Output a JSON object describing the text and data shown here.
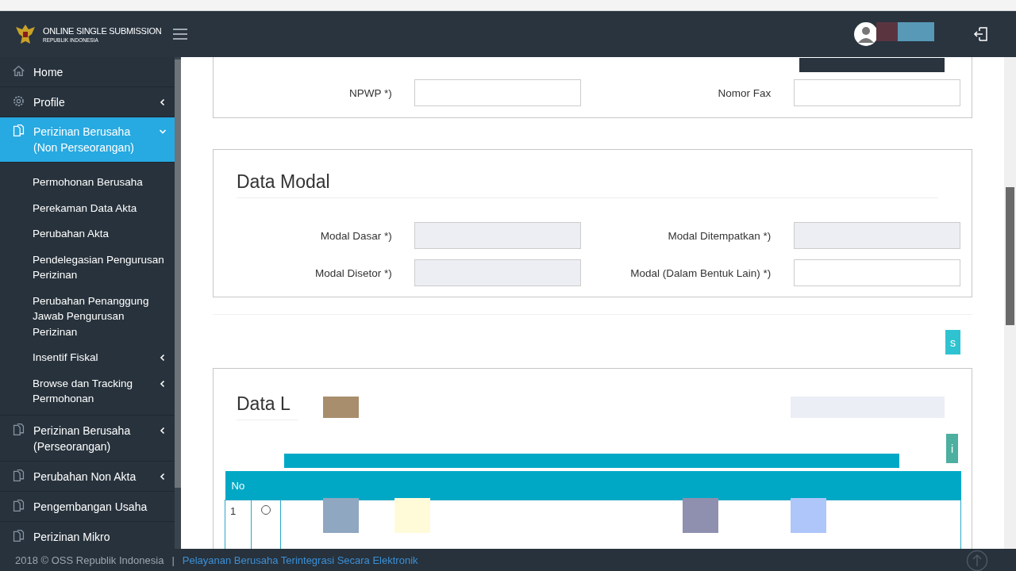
{
  "header": {
    "brand_title": "ONLINE SINGLE SUBMISSION",
    "brand_subtitle": "REPUBLIK INDONESIA"
  },
  "sidebar": {
    "items": [
      {
        "label": "Home",
        "kind": "home",
        "selected": false,
        "expandable": false
      },
      {
        "label": "Profile",
        "kind": "gear",
        "selected": false,
        "expandable": true,
        "expanded": false
      },
      {
        "label": "Perizinan Berusaha (Non Perseorangan)",
        "kind": "document",
        "selected": true,
        "expandable": true,
        "expanded": true,
        "children": [
          {
            "label": "Permohonan Berusaha",
            "expandable": false
          },
          {
            "label": "Perekaman Data Akta",
            "expandable": false
          },
          {
            "label": "Perubahan Akta",
            "expandable": false
          },
          {
            "label": "Pendelegasian Pengurusan Perizinan",
            "expandable": false
          },
          {
            "label": "Perubahan Penanggung Jawab Pengurusan Perizinan",
            "expandable": false
          },
          {
            "label": "Insentif Fiskal",
            "expandable": true
          },
          {
            "label": "Browse dan Tracking Permohonan",
            "expandable": true
          }
        ]
      },
      {
        "label": "Perizinan Berusaha (Perseorangan)",
        "kind": "document",
        "selected": false,
        "expandable": true,
        "expanded": false
      },
      {
        "label": "Perubahan Non Akta",
        "kind": "document",
        "selected": false,
        "expandable": true,
        "expanded": false
      },
      {
        "label": "Pengembangan Usaha",
        "kind": "document",
        "selected": false,
        "expandable": false
      },
      {
        "label": "Perizinan Mikro",
        "kind": "document",
        "selected": false,
        "expandable": false
      }
    ]
  },
  "sections": [
    {
      "rows": [
        [
          {
            "label": "NPWP *)",
            "disabled": false
          },
          {
            "label": "Nomor Fax",
            "disabled": false
          }
        ]
      ]
    },
    {
      "title": "Data Modal",
      "rows": [
        [
          {
            "label": "Modal Dasar *)",
            "disabled": true
          },
          {
            "label": "Modal Ditempatkan *)",
            "disabled": true
          }
        ],
        [
          {
            "label": "Modal Disetor *)",
            "disabled": true
          },
          {
            "label": "Modal (Dalam Bentuk Lain) *)",
            "disabled": false
          }
        ]
      ]
    }
  ],
  "save_button": {
    "label": "s"
  },
  "legal_section": {
    "title": "Data L",
    "button": {
      "label": "i"
    },
    "table": {
      "columns": [
        "No"
      ],
      "rows": [
        {
          "no": "1",
          "selected": false
        }
      ]
    }
  },
  "footer": {
    "copyright": "2018 © OSS Republik Indonesia",
    "separator": "|",
    "link": "Pelayanan Berusaha Terintegrasi Secara Elektronik"
  }
}
